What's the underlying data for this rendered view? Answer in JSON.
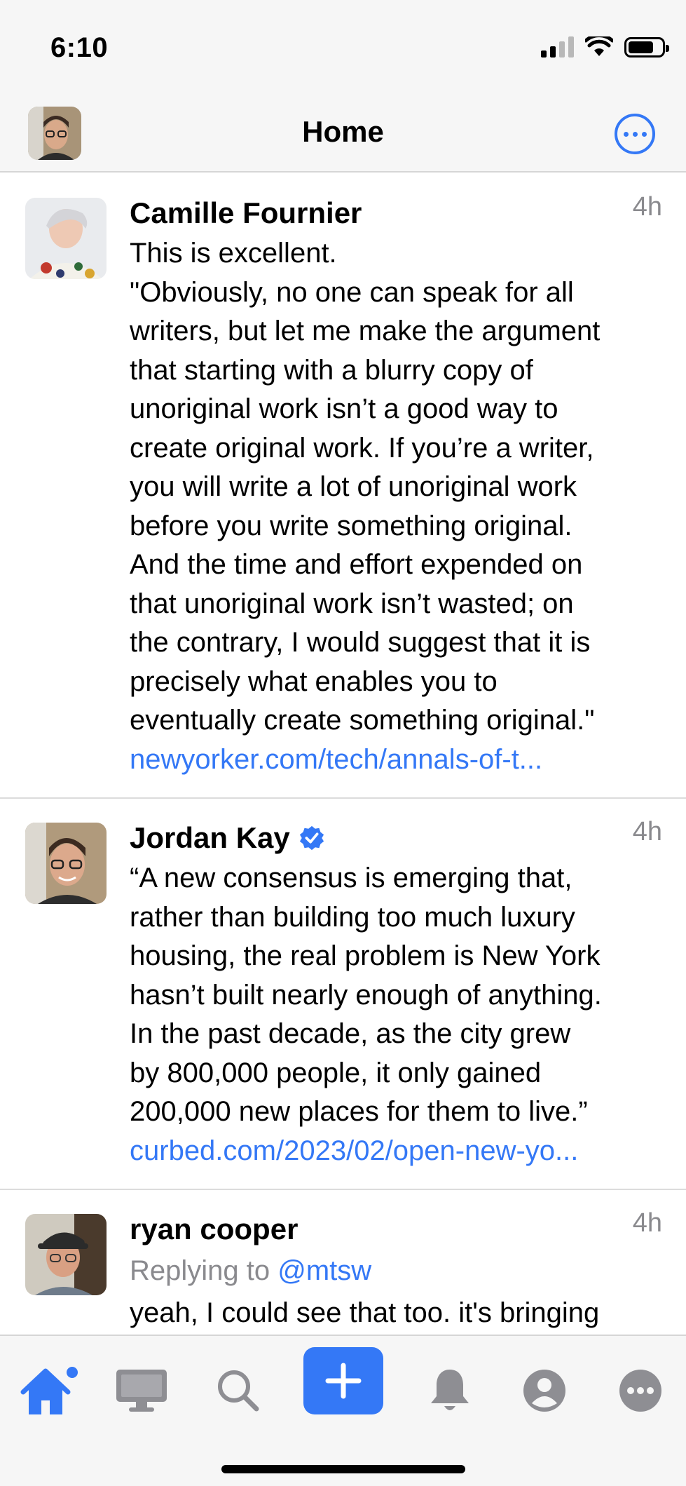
{
  "status": {
    "time": "6:10"
  },
  "header": {
    "title": "Home"
  },
  "posts": [
    {
      "author": "Camille Fournier",
      "time": "4h",
      "body": "This is excellent.\n\"Obviously, no one can speak for all\nwriters, but let me make the argument\nthat starting with a blurry copy of\nunoriginal work isn’t a good way to\ncreate original work. If you’re a writer,\nyou will write a lot of unoriginal work\nbefore you write something original.\nAnd the time and effort expended on\nthat unoriginal work isn’t wasted; on\nthe contrary, I would suggest that it is\nprecisely what enables you to\neventually create something original.\"",
      "link": "newyorker.com/tech/annals-of-t..."
    },
    {
      "author": "Jordan Kay",
      "verified": true,
      "time": "4h",
      "body": "“A new consensus is emerging that,\nrather than building too much luxury\nhousing, the real problem is New York\nhasn’t built nearly enough of anything.\nIn the past decade, as the city grew\nby 800,000 people, it only gained\n200,000 new places for them to live.”",
      "link": "curbed.com/2023/02/open-new-yo..."
    },
    {
      "author": "ryan cooper",
      "time": "4h",
      "reply_prefix": "Replying to",
      "reply_handle": "@mtsw",
      "body": "yeah, I could see that too. it's bringing"
    }
  ],
  "tabs": [
    "home-icon",
    "desktop-icon",
    "search-icon",
    "compose-icon",
    "bell-icon",
    "profile-icon",
    "more-icon"
  ],
  "colors": {
    "accent": "#3478f6",
    "secondary_text": "#8a8a8e"
  }
}
